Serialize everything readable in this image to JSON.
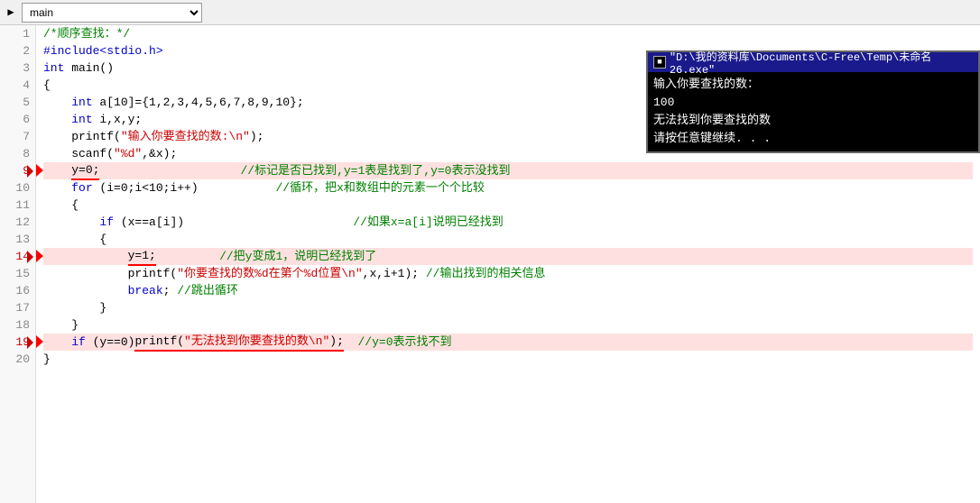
{
  "toolbar": {
    "icon": "▶",
    "select_value": "main",
    "dropdown_label": "main"
  },
  "line_numbers": [
    1,
    2,
    3,
    4,
    5,
    6,
    7,
    8,
    9,
    10,
    11,
    12,
    13,
    14,
    15,
    16,
    17,
    18,
    19,
    20
  ],
  "breakpoint_lines": [
    9,
    14,
    19
  ],
  "highlighted_lines": [
    9,
    14,
    19
  ],
  "code_lines": [
    {
      "num": 1,
      "content": "/*顺序查找：*/",
      "type": "comment"
    },
    {
      "num": 2,
      "content": "#include<stdio.h>",
      "type": "directive"
    },
    {
      "num": 3,
      "content": "int main()",
      "type": "plain"
    },
    {
      "num": 4,
      "content": "{",
      "type": "plain"
    },
    {
      "num": 5,
      "content": "    int a[10]={1,2,3,4,5,6,7,8,9,10};",
      "type": "mixed"
    },
    {
      "num": 6,
      "content": "    int i,x,y;",
      "type": "mixed"
    },
    {
      "num": 7,
      "content": "    printf(\"输入你要查找的数:\\n\");",
      "type": "mixed"
    },
    {
      "num": 8,
      "content": "    scanf(\"%d\",&x);",
      "type": "mixed"
    },
    {
      "num": 9,
      "content": "    y=0;                    //标记是否已找到,y=1表是找到了,y=0表示没找到",
      "type": "mixed_comment"
    },
    {
      "num": 10,
      "content": "    for (i=0;i<10;i++)           //循环，把x和数组中的元素一个个比较",
      "type": "mixed_comment"
    },
    {
      "num": 11,
      "content": "    {",
      "type": "plain"
    },
    {
      "num": 12,
      "content": "        if (x==a[i])                    //如果x=a[i]说明已经找到",
      "type": "mixed_comment"
    },
    {
      "num": 13,
      "content": "        {",
      "type": "plain"
    },
    {
      "num": 14,
      "content": "            y=1;         //把y变成1，说明已经找到了",
      "type": "mixed_comment"
    },
    {
      "num": 15,
      "content": "            printf(\"你要查找的数%d在第个%d位置\\n\",x,i+1);  //输出找到的相关信息",
      "type": "mixed_comment"
    },
    {
      "num": 16,
      "content": "            break;  //跳出循环",
      "type": "mixed_comment"
    },
    {
      "num": 17,
      "content": "        }",
      "type": "plain"
    },
    {
      "num": 18,
      "content": "    }",
      "type": "plain"
    },
    {
      "num": 19,
      "content": "    if (y==0)printf(\"无法找到你要查找的数\\n\");  //y=0表示找不到",
      "type": "mixed_comment"
    },
    {
      "num": 20,
      "content": "}",
      "type": "plain"
    }
  ],
  "console": {
    "title": "\"D:\\我的资料库\\Documents\\C-Free\\Temp\\未命名26.exe\"",
    "lines": [
      "输入你要查找的数：",
      "100",
      "无法找到你要查找的数",
      "请按任意键继续. . ."
    ]
  }
}
